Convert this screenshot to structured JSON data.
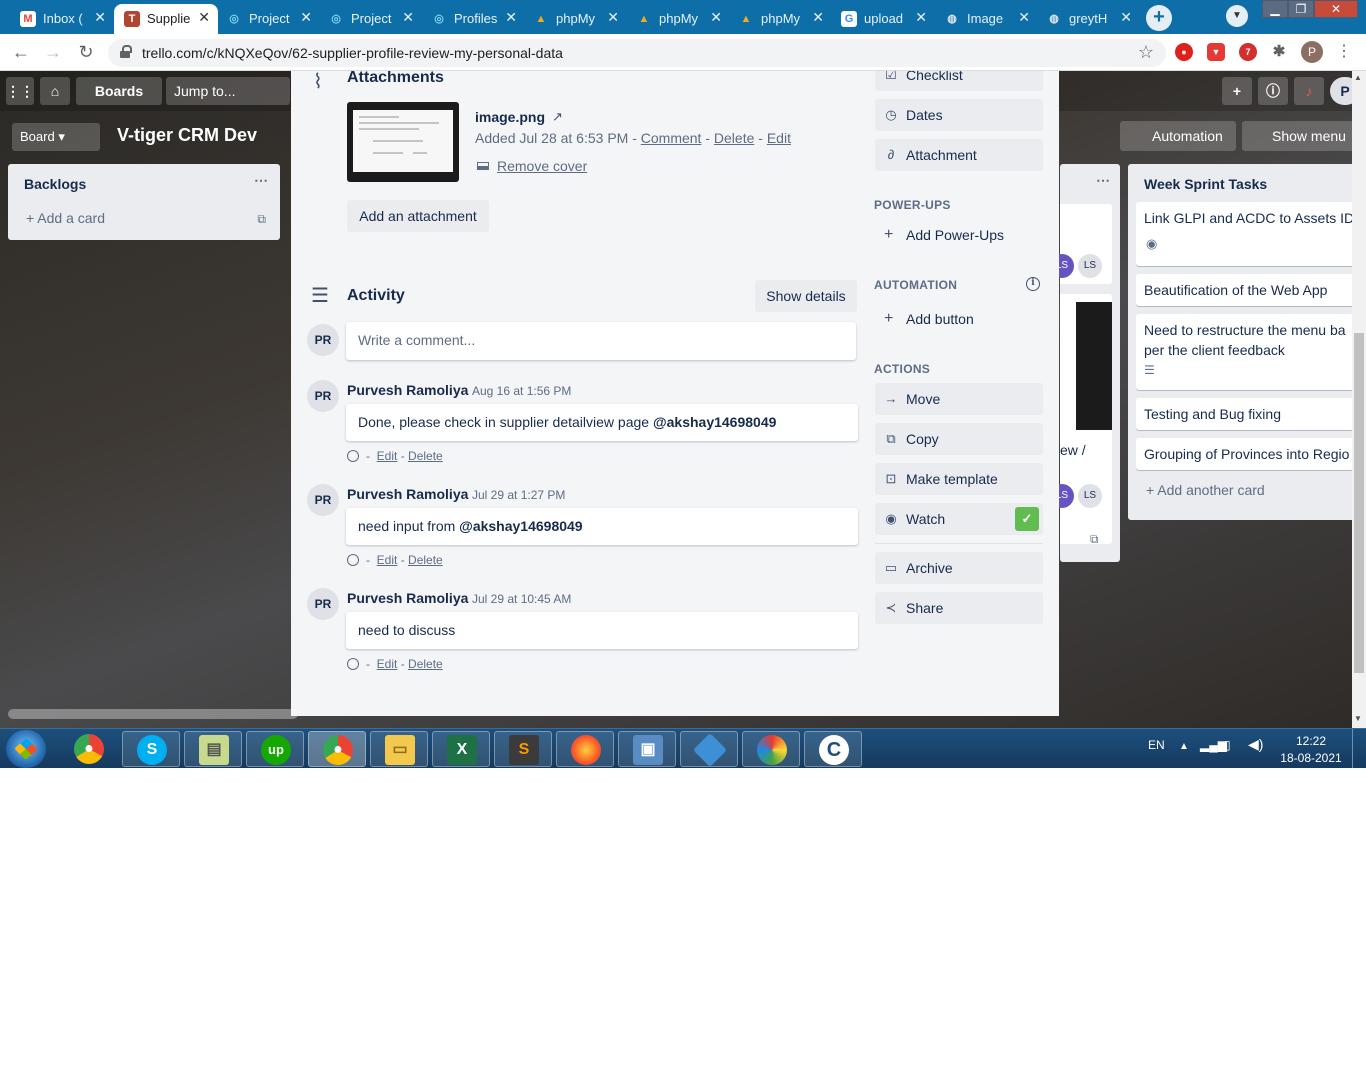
{
  "browser": {
    "tabs": [
      {
        "label": "Inbox (",
        "icon": "gmail-icon"
      },
      {
        "label": "Supplie",
        "icon": "trello-icon",
        "active": true
      },
      {
        "label": "Project",
        "icon": "globe-icon"
      },
      {
        "label": "Project",
        "icon": "globe-icon"
      },
      {
        "label": "Profiles",
        "icon": "globe-icon"
      },
      {
        "label": "phpMy",
        "icon": "phpmyadmin-icon"
      },
      {
        "label": "phpMy",
        "icon": "phpmyadmin-icon"
      },
      {
        "label": "phpMy",
        "icon": "phpmyadmin-icon"
      },
      {
        "label": "upload",
        "icon": "google-icon"
      },
      {
        "label": "Image",
        "icon": "globe-icon"
      },
      {
        "label": "greytH",
        "icon": "globe-icon"
      }
    ],
    "url": "trello.com/c/kNQXeQov/62-supplier-profile-review-my-personal-data",
    "extension_badge": "7",
    "profile_initial": "P"
  },
  "board": {
    "nav_boards": "Boards",
    "nav_jump": "Jump to...",
    "board_label": "Board",
    "title": "V-tiger CRM Dev",
    "automation": "Automation",
    "show_menu": "Show menu",
    "lists": [
      {
        "title": "Backlogs",
        "add_card": "Add a card"
      },
      {
        "title": "Week Sprint Tasks",
        "add_card": "Add another card",
        "cards": [
          "Link GLPI and ACDC to Assets ID",
          "Beautification of the Web App",
          "Need to restructure the menu ba",
          "per the client feedback",
          "Testing and Bug fixing",
          "Grouping of Provinces into Regio"
        ]
      }
    ],
    "partial_card_text": "ew /",
    "member_initials": "LS"
  },
  "card": {
    "attachments": {
      "heading": "Attachments",
      "file_name": "image.png",
      "added_prefix": "Added Jul 28 at 6:53 PM - ",
      "comment": "Comment",
      "delete": "Delete",
      "edit": "Edit",
      "sep": " - ",
      "remove_cover": "Remove cover",
      "add_attachment": "Add an attachment"
    },
    "activity": {
      "heading": "Activity",
      "show_details": "Show details",
      "placeholder": "Write a comment...",
      "comments": [
        {
          "initials": "PR",
          "author": "Purvesh Ramoliya",
          "time": "Aug 16 at 1:56 PM",
          "text": "Done, please check in supplier detailview page ",
          "mention": "@akshay14698049"
        },
        {
          "initials": "PR",
          "author": "Purvesh Ramoliya",
          "time": "Jul 29 at 1:27 PM",
          "text": "need input from ",
          "mention": "@akshay14698049"
        },
        {
          "initials": "PR",
          "author": "Purvesh Ramoliya",
          "time": "Jul 29 at 10:45 AM",
          "text": "need to discuss",
          "mention": ""
        }
      ],
      "edit": "Edit",
      "delete": "Delete",
      "dash": "-",
      "current_user_initials": "PR"
    },
    "sidebar": {
      "checklist": "Checklist",
      "dates": "Dates",
      "attachment": "Attachment",
      "powerups_label": "POWER-UPS",
      "add_powerups": "Add Power-Ups",
      "automation_label": "AUTOMATION",
      "add_button": "Add button",
      "actions_label": "ACTIONS",
      "move": "Move",
      "copy": "Copy",
      "make_template": "Make template",
      "watch": "Watch",
      "archive": "Archive",
      "share": "Share"
    }
  },
  "taskbar": {
    "language": "EN",
    "time": "12:22",
    "date": "18-08-2021"
  },
  "colors": {
    "tab_strip": "#0e6ea8",
    "modal_bg": "#f4f5f7",
    "watch_green": "#61bd4f",
    "taskbar": "#1d4f7d"
  }
}
